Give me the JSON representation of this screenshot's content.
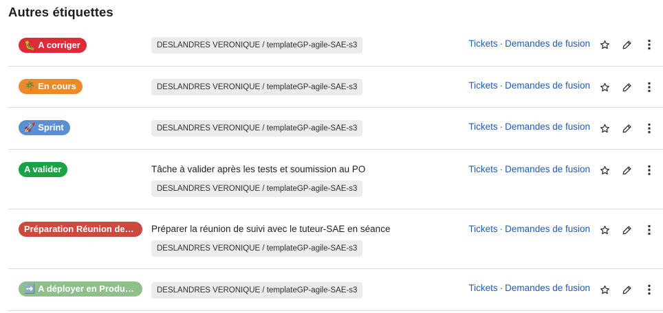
{
  "section": {
    "title": "Autres étiquettes"
  },
  "labels": [
    {
      "name": "A corriger",
      "emoji": "🐛",
      "color": "#dd2b3a",
      "description": "",
      "path": "DESLANDRES VERONIQUE / templateGP-agile-SAE-s3",
      "tickets_label": "Tickets",
      "separator": "·",
      "merge_label": "Demandes de fusion"
    },
    {
      "name": "En cours",
      "emoji": "🌴",
      "color": "#ec8a2a",
      "description": "",
      "path": "DESLANDRES VERONIQUE / templateGP-agile-SAE-s3",
      "tickets_label": "Tickets",
      "separator": "·",
      "merge_label": "Demandes de fusion"
    },
    {
      "name": "Sprint",
      "emoji": "🚀",
      "color": "#5c8fd0",
      "description": "",
      "path": "DESLANDRES VERONIQUE / templateGP-agile-SAE-s3",
      "tickets_label": "Tickets",
      "separator": "·",
      "merge_label": "Demandes de fusion"
    },
    {
      "name": "A valider",
      "emoji": "",
      "color": "#1aa344",
      "description": "Tâche à valider après les tests et soumission au PO",
      "path": "DESLANDRES VERONIQUE / templateGP-agile-SAE-s3",
      "tickets_label": "Tickets",
      "separator": "·",
      "merge_label": "Demandes de fusion"
    },
    {
      "name": "Préparation Réunion de su...",
      "emoji": "",
      "color": "#cc4a3d",
      "description": "Préparer la réunion de suivi avec le tuteur-SAE en séance",
      "path": "DESLANDRES VERONIQUE / templateGP-agile-SAE-s3",
      "tickets_label": "Tickets",
      "separator": "·",
      "merge_label": "Demandes de fusion"
    },
    {
      "name": "A déployer en Producti...",
      "emoji": "➡️",
      "color": "#8fbf8a",
      "description": "",
      "path": "DESLANDRES VERONIQUE / templateGP-agile-SAE-s3",
      "tickets_label": "Tickets",
      "separator": "·",
      "merge_label": "Demandes de fusion"
    }
  ],
  "icons": {
    "star": "star-icon",
    "edit": "pencil-icon",
    "more": "more-vertical-icon"
  }
}
